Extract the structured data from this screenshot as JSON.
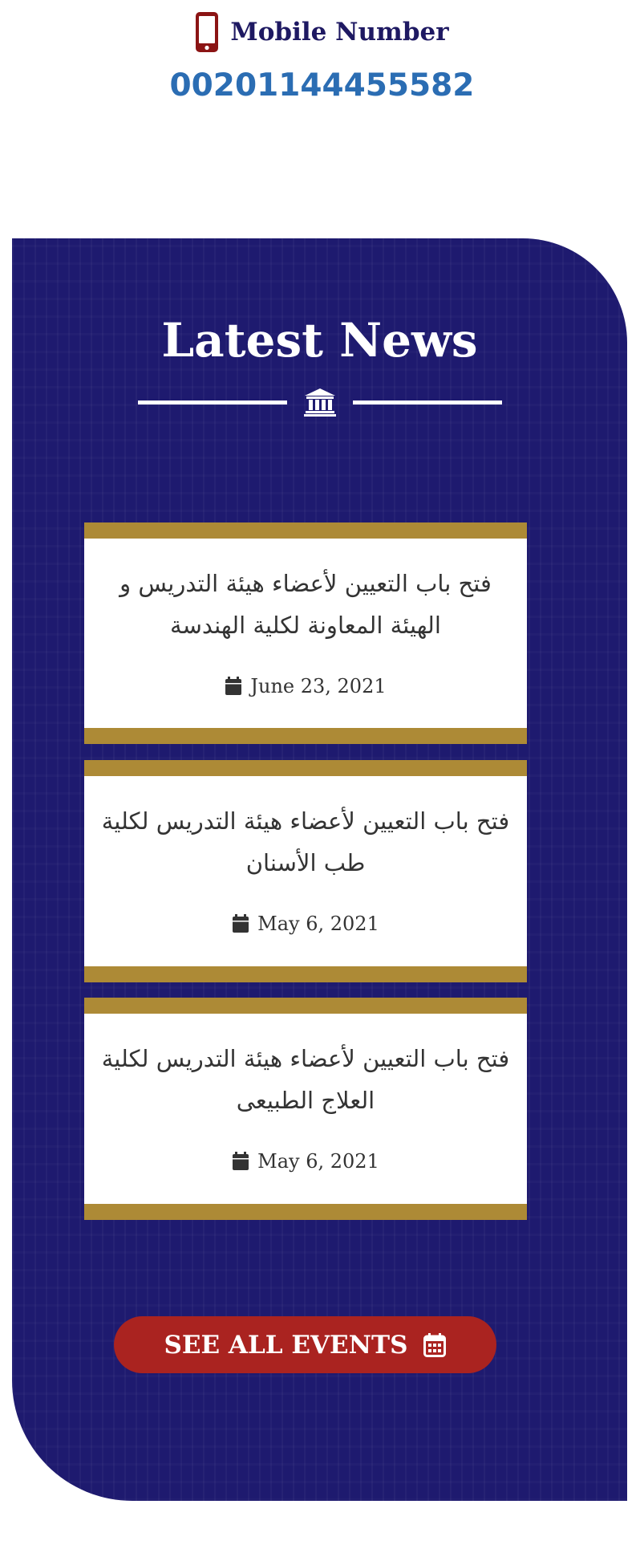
{
  "contact": {
    "icon": "mobile-phone-icon",
    "label": "Mobile Number",
    "number": "00201144455582",
    "colors": {
      "label": "#1e1962",
      "number": "#2b6db3",
      "icon": "#8b1414"
    }
  },
  "news": {
    "title": "Latest News",
    "divider_icon": "university-building-icon",
    "items": [
      {
        "title": "فتح باب التعيين لأعضاء هيئة التدريس و الهيئة المعاونة لكلية الهندسة",
        "date": "June 23, 2021",
        "icon": "calendar-icon"
      },
      {
        "title": "فتح باب التعيين لأعضاء هيئة التدريس لكلية طب الأسنان",
        "date": "May 6, 2021",
        "icon": "calendar-icon"
      },
      {
        "title": "فتح باب التعيين لأعضاء هيئة التدريس لكلية العلاج الطبيعى",
        "date": "May 6, 2021",
        "icon": "calendar-icon"
      }
    ],
    "button": {
      "label": "SEE ALL EVENTS",
      "icon": "calendar-grid-icon"
    },
    "colors": {
      "section_bg": "#1e1a6f",
      "card_border": "#ad8a36",
      "button_bg": "#aa2320"
    }
  }
}
